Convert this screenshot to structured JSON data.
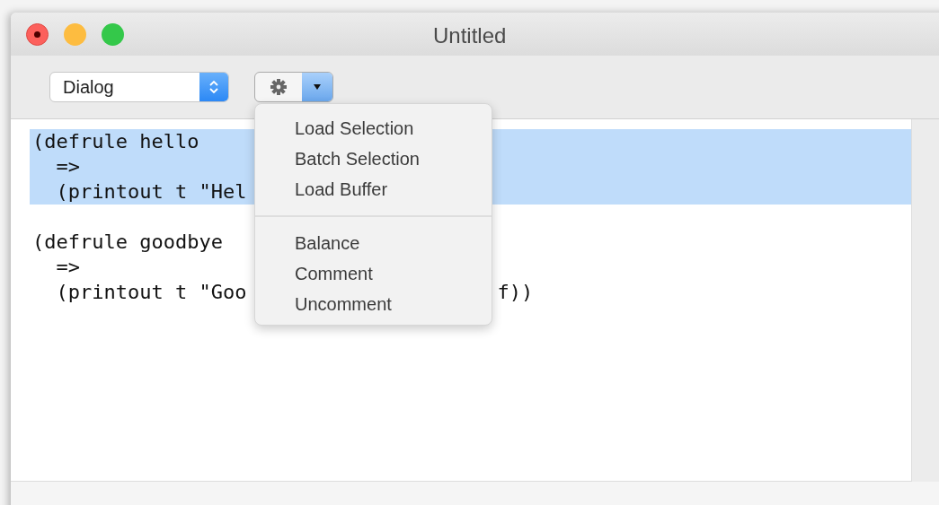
{
  "window": {
    "title": "Untitled"
  },
  "toolbar": {
    "mode_popup": {
      "value": "Dialog"
    },
    "action_menu": {
      "expanded": true
    }
  },
  "editor": {
    "lines": [
      {
        "text": "(defrule hello",
        "selected": true
      },
      {
        "text": "  =>",
        "selected": true
      },
      {
        "text": "  (printout t \"Hel",
        "selected": true
      },
      {
        "selected": false
      },
      {
        "text": "(defrule goodbye",
        "selected": false
      },
      {
        "text": "  =>",
        "selected": false
      },
      {
        "text": "  (printout t \"Goo",
        "tail": "f))",
        "selected": false
      }
    ]
  },
  "menu": {
    "groups": [
      {
        "items": [
          {
            "label": "Load Selection"
          },
          {
            "label": "Batch Selection"
          },
          {
            "label": "Load Buffer"
          }
        ]
      },
      {
        "items": [
          {
            "label": "Balance"
          },
          {
            "label": "Comment"
          },
          {
            "label": "Uncomment"
          }
        ]
      }
    ]
  }
}
